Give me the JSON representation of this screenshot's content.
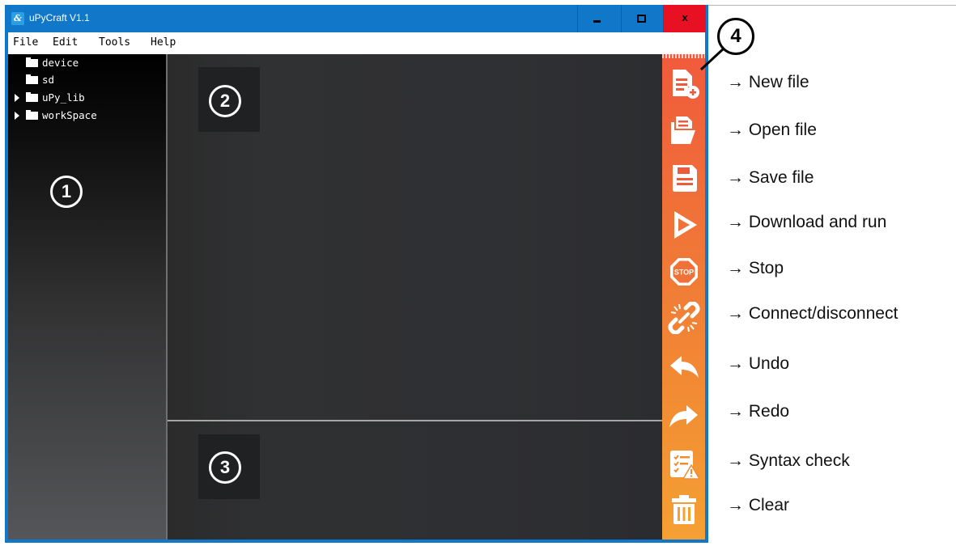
{
  "window": {
    "title": "uPyCraft V1.1",
    "app_icon_glyph": "&",
    "controls": {
      "minimize": "minimize-icon",
      "maximize": "maximize-icon",
      "close_label": "x"
    }
  },
  "menu": [
    "File",
    "Edit",
    "Tools",
    "Help"
  ],
  "file_tree": [
    {
      "label": "device",
      "expandable": false
    },
    {
      "label": "sd",
      "expandable": false
    },
    {
      "label": "uPy_lib",
      "expandable": true
    },
    {
      "label": "workSpace",
      "expandable": true
    }
  ],
  "callouts": {
    "file_browser": "1",
    "editor": "2",
    "terminal": "3",
    "toolbar": "4"
  },
  "toolbar": {
    "colors": {
      "top": "#f05a3c",
      "bottom": "#f4a033"
    },
    "items": [
      {
        "icon": "new-file-icon",
        "label": "New file"
      },
      {
        "icon": "open-file-icon",
        "label": "Open file"
      },
      {
        "icon": "save-file-icon",
        "label": "Save file"
      },
      {
        "icon": "download-and-run-icon",
        "label": "Download and run"
      },
      {
        "icon": "stop-icon",
        "label": "Stop",
        "glyph": "STOP"
      },
      {
        "icon": "connect-disconnect-icon",
        "label": "Connect/disconnect"
      },
      {
        "icon": "undo-icon",
        "label": "Undo"
      },
      {
        "icon": "redo-icon",
        "label": "Redo"
      },
      {
        "icon": "syntax-check-icon",
        "label": "Syntax check"
      },
      {
        "icon": "clear-icon",
        "label": "Clear"
      }
    ]
  }
}
